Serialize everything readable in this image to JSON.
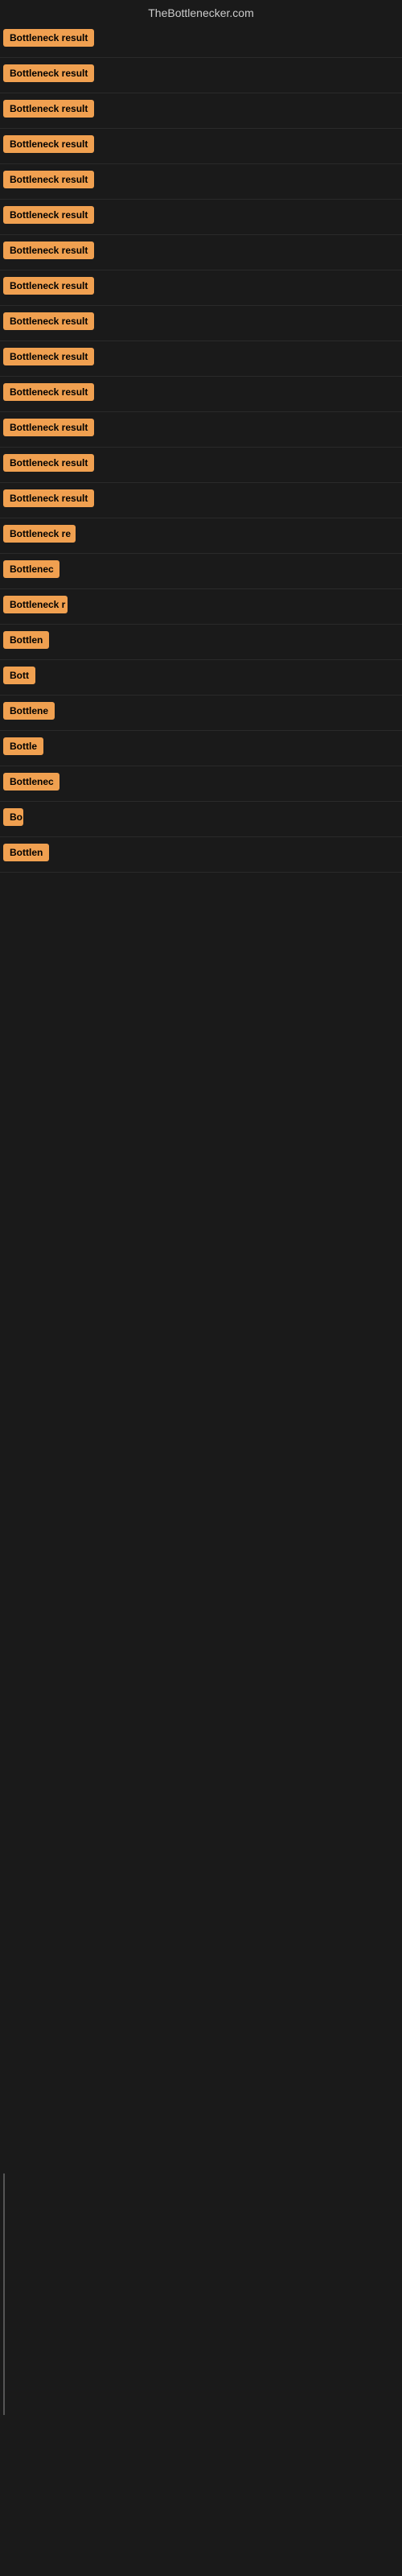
{
  "site": {
    "title": "TheBottlenecker.com"
  },
  "results": [
    {
      "id": 1,
      "label": "Bottleneck result",
      "width": 130
    },
    {
      "id": 2,
      "label": "Bottleneck result",
      "width": 130
    },
    {
      "id": 3,
      "label": "Bottleneck result",
      "width": 130
    },
    {
      "id": 4,
      "label": "Bottleneck result",
      "width": 130
    },
    {
      "id": 5,
      "label": "Bottleneck result",
      "width": 130
    },
    {
      "id": 6,
      "label": "Bottleneck result",
      "width": 130
    },
    {
      "id": 7,
      "label": "Bottleneck result",
      "width": 130
    },
    {
      "id": 8,
      "label": "Bottleneck result",
      "width": 130
    },
    {
      "id": 9,
      "label": "Bottleneck result",
      "width": 130
    },
    {
      "id": 10,
      "label": "Bottleneck result",
      "width": 130
    },
    {
      "id": 11,
      "label": "Bottleneck result",
      "width": 130
    },
    {
      "id": 12,
      "label": "Bottleneck result",
      "width": 130
    },
    {
      "id": 13,
      "label": "Bottleneck result",
      "width": 130
    },
    {
      "id": 14,
      "label": "Bottleneck result",
      "width": 130
    },
    {
      "id": 15,
      "label": "Bottleneck re",
      "width": 90
    },
    {
      "id": 16,
      "label": "Bottlenec",
      "width": 70
    },
    {
      "id": 17,
      "label": "Bottleneck r",
      "width": 80
    },
    {
      "id": 18,
      "label": "Bottlen",
      "width": 60
    },
    {
      "id": 19,
      "label": "Bott",
      "width": 40
    },
    {
      "id": 20,
      "label": "Bottlene",
      "width": 65
    },
    {
      "id": 21,
      "label": "Bottle",
      "width": 50
    },
    {
      "id": 22,
      "label": "Bottlenec",
      "width": 70
    },
    {
      "id": 23,
      "label": "Bo",
      "width": 25
    },
    {
      "id": 24,
      "label": "Bottlen",
      "width": 60
    }
  ]
}
